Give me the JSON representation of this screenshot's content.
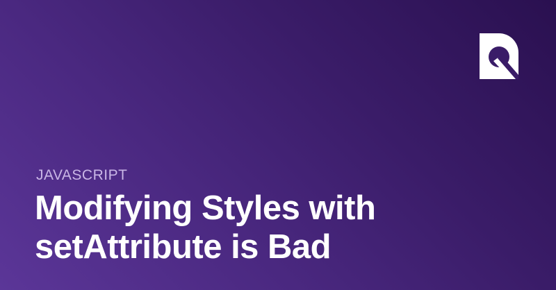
{
  "card": {
    "category": "JAVASCRIPT",
    "title_lines": [
      "Modifying Styles with",
      "setAttribute is Bad"
    ],
    "logo_icon": "brand-logo-icon"
  },
  "colors": {
    "background_start": "#5b3698",
    "background_end": "#2a1050",
    "category_text": "#c9b6e6",
    "title_text": "#ffffff",
    "logo": "#ffffff"
  }
}
